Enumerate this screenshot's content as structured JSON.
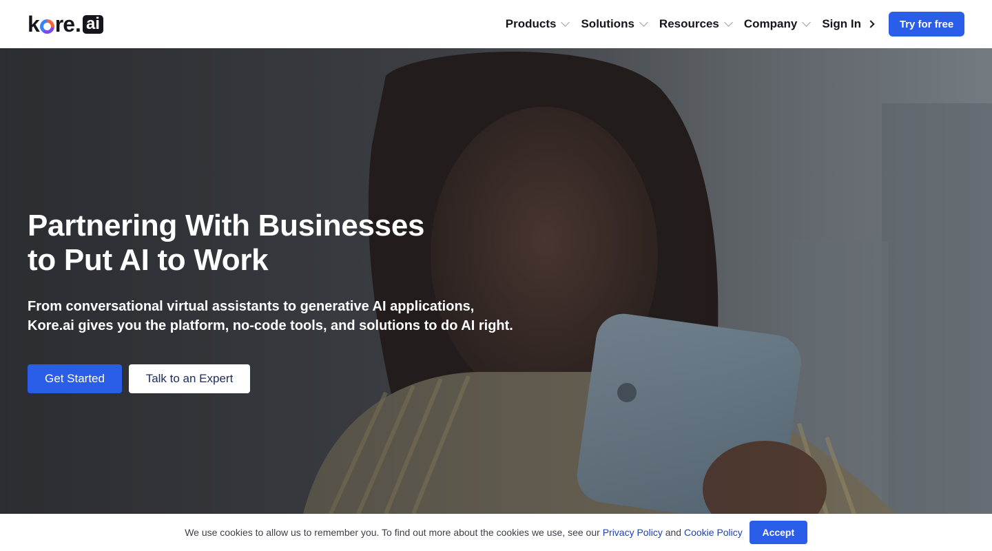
{
  "header": {
    "logo": {
      "text": "kore",
      "dot": ".",
      "badge": "ai"
    },
    "nav": [
      {
        "label": "Products"
      },
      {
        "label": "Solutions"
      },
      {
        "label": "Resources"
      },
      {
        "label": "Company"
      }
    ],
    "signin_label": "Sign In",
    "cta_label": "Try for free"
  },
  "hero": {
    "title_line1": "Partnering With Businesses",
    "title_line2": "to Put AI to Work",
    "subtitle_line1": "From conversational virtual assistants to generative AI applications,",
    "subtitle_line2": "Kore.ai gives you the platform, no-code tools, and solutions to do AI right.",
    "primary_button": "Get Started",
    "secondary_button": "Talk to an Expert"
  },
  "cookie": {
    "text_before": "We use cookies to allow us to remember you. To find out more about the cookies we use, see our ",
    "privacy_link": "Privacy Policy",
    "and": " and ",
    "cookie_link": "Cookie Policy",
    "accept_label": "Accept"
  },
  "colors": {
    "accent": "#2b5ee8",
    "text_dark": "#14161b",
    "link": "#1f3fb5"
  },
  "icons": {
    "nav_dropdown": "chevron-down-icon",
    "signin_arrow": "chevron-right-icon"
  }
}
